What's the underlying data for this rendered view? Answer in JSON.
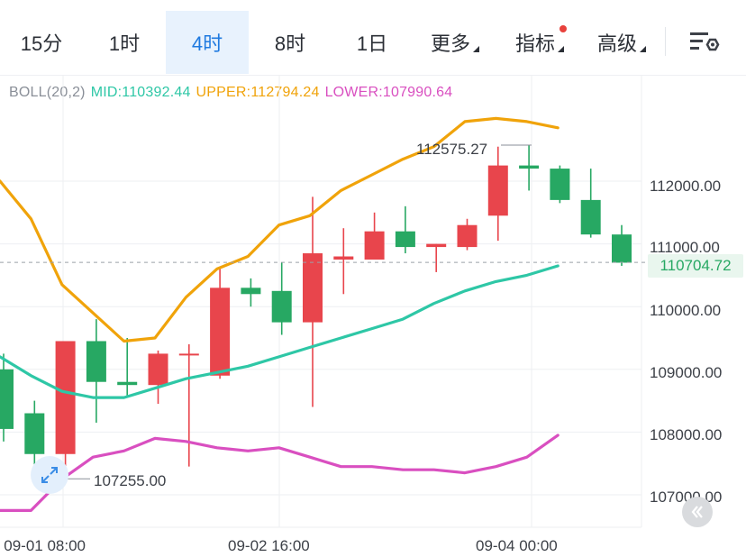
{
  "tabs": [
    {
      "label": "15分",
      "active": false,
      "has_menu": false
    },
    {
      "label": "1时",
      "active": false,
      "has_menu": false
    },
    {
      "label": "4时",
      "active": true,
      "has_menu": false
    },
    {
      "label": "8时",
      "active": false,
      "has_menu": false
    },
    {
      "label": "1日",
      "active": false,
      "has_menu": false
    },
    {
      "label": "更多",
      "active": false,
      "has_menu": true
    },
    {
      "label": "指标",
      "active": false,
      "has_menu": true
    },
    {
      "label": "高级",
      "active": false,
      "has_menu": true
    }
  ],
  "indicator": {
    "name": "BOLL(20,2)",
    "mid": "MID:110392.44",
    "upper": "UPPER:112794.24",
    "lower": "LOWER:107990.64",
    "colors": {
      "name": "#8a8f98",
      "mid": "#2ec7a6",
      "upper": "#f0a30a",
      "lower": "#d94fc0"
    }
  },
  "colors": {
    "up": "#e8454c",
    "down": "#27a863",
    "grid": "#edeff2"
  },
  "chart_data": {
    "type": "candlestick",
    "ylim": [
      106650,
      112950
    ],
    "y_ticks": [
      "112000.00",
      "111000.00",
      "110000.00",
      "109000.00",
      "108000.00",
      "107000.00"
    ],
    "x_ticks": [
      "09-01 08:00",
      "09-02 16:00",
      "09-04 00:00"
    ],
    "current_price": "110704.72",
    "annotations": {
      "high": "112575.27",
      "low": "107255.00"
    },
    "candles": [
      {
        "o": 109000,
        "c": 108050,
        "h": 109250,
        "l": 107850
      },
      {
        "o": 108300,
        "c": 107650,
        "h": 108500,
        "l": 107400
      },
      {
        "o": 107650,
        "c": 109450,
        "h": 109450,
        "l": 107255
      },
      {
        "o": 109450,
        "c": 108800,
        "h": 109800,
        "l": 108150
      },
      {
        "o": 108800,
        "c": 108750,
        "h": 109500,
        "l": 108550
      },
      {
        "o": 108750,
        "c": 109250,
        "h": 109300,
        "l": 108450
      },
      {
        "o": 109250,
        "c": 109250,
        "h": 109400,
        "l": 107450
      },
      {
        "o": 108900,
        "c": 110300,
        "h": 110600,
        "l": 108850
      },
      {
        "o": 110300,
        "c": 110200,
        "h": 110450,
        "l": 110000
      },
      {
        "o": 110250,
        "c": 109750,
        "h": 110700,
        "l": 109550
      },
      {
        "o": 109750,
        "c": 110850,
        "h": 111750,
        "l": 108400
      },
      {
        "o": 110750,
        "c": 110800,
        "h": 111250,
        "l": 110200
      },
      {
        "o": 110750,
        "c": 111200,
        "h": 111500,
        "l": 110750
      },
      {
        "o": 111200,
        "c": 110950,
        "h": 111600,
        "l": 110850
      },
      {
        "o": 110950,
        "c": 111000,
        "h": 111000,
        "l": 110550
      },
      {
        "o": 110950,
        "c": 111300,
        "h": 111400,
        "l": 110900
      },
      {
        "o": 111450,
        "c": 112250,
        "h": 112550,
        "l": 111050
      },
      {
        "o": 112250,
        "c": 112200,
        "h": 112575.27,
        "l": 111850
      },
      {
        "o": 112200,
        "c": 111700,
        "h": 112250,
        "l": 111650
      },
      {
        "o": 111700,
        "c": 111150,
        "h": 112200,
        "l": 111100
      },
      {
        "o": 111150,
        "c": 110700,
        "h": 111300,
        "l": 110650
      }
    ],
    "series": [
      {
        "name": "UPPER",
        "values": [
          112000,
          111400,
          110350,
          109900,
          109450,
          109500,
          110150,
          110600,
          110800,
          111300,
          111450,
          111850,
          112100,
          112350,
          112550,
          112950,
          113000,
          112950,
          112850
        ]
      },
      {
        "name": "MID",
        "values": [
          109200,
          108900,
          108650,
          108550,
          108550,
          108700,
          108850,
          108950,
          109050,
          109200,
          109350,
          109500,
          109650,
          109800,
          110050,
          110250,
          110400,
          110500,
          110650
        ]
      },
      {
        "name": "LOWER",
        "values": [
          106750,
          106750,
          107250,
          107600,
          107700,
          107900,
          107850,
          107750,
          107700,
          107750,
          107600,
          107450,
          107450,
          107400,
          107400,
          107350,
          107450,
          107600,
          107950
        ]
      }
    ]
  }
}
